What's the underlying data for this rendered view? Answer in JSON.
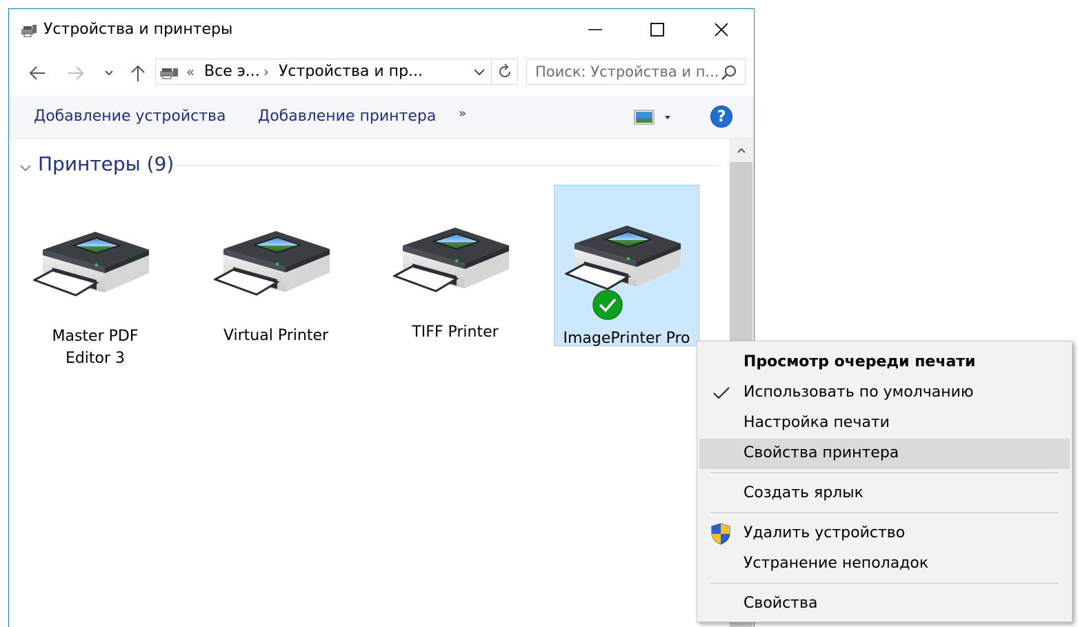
{
  "window": {
    "title": "Устройства и принтеры",
    "title_icon": "devices-printers-icon"
  },
  "controls": {
    "minimize_icon": "minimize-icon",
    "maximize_icon": "maximize-icon",
    "close_icon": "close-icon"
  },
  "navigation": {
    "back_icon": "arrow-left-icon",
    "forward_icon": "arrow-right-icon",
    "recent_icon": "chevron-down-icon",
    "up_icon": "arrow-up-icon",
    "breadcrumb_overflow": "«",
    "crumbs": [
      "Все э...",
      "Устройства и пр..."
    ],
    "separator": "›",
    "refresh_icon": "refresh-icon",
    "search_placeholder": "Поиск: Устройства и п..."
  },
  "commands": {
    "add_device": "Добавление устройства",
    "add_printer": "Добавление принтера",
    "more": "»",
    "view_icon": "change-view-icon",
    "help": "?"
  },
  "group": {
    "title": "Принтеры (9)"
  },
  "devices": [
    {
      "label_line1": "Master PDF",
      "label_line2": "Editor 3",
      "selected": false,
      "default": false
    },
    {
      "label_line1": "Virtual Printer",
      "label_line2": "",
      "selected": false,
      "default": false
    },
    {
      "label_line1": "TIFF Printer",
      "label_line2": "",
      "selected": false,
      "default": false
    },
    {
      "label_line1": "ImagePrinter Pro",
      "label_line2": "",
      "selected": true,
      "default": true
    }
  ],
  "context_menu": {
    "items": [
      {
        "label": "Просмотр очереди печати",
        "bold": true
      },
      {
        "label": "Использовать по умолчанию",
        "checked": true
      },
      {
        "label": "Настройка печати"
      },
      {
        "label": "Свойства принтера",
        "highlighted": true
      },
      {
        "label": "Создать ярлык"
      },
      {
        "label": "Удалить устройство",
        "icon": "uac-shield-icon"
      },
      {
        "label": "Устранение неполадок"
      },
      {
        "label": "Свойства"
      }
    ]
  },
  "colors": {
    "accent": "#1c85d4",
    "link_text": "#1e3287",
    "selection": "#cce8ff",
    "menu_bg": "#f2f2f2",
    "menu_hover": "#dadada",
    "ok_green": "#10a020"
  }
}
